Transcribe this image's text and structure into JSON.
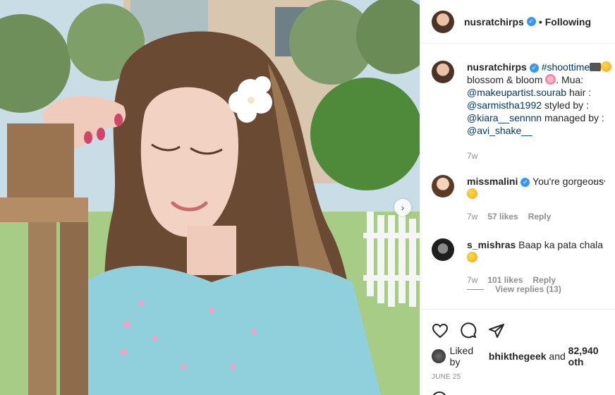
{
  "post": {
    "username": "nusratchirps",
    "follow_label": "Following",
    "verified_mark": "✓",
    "dot": "•"
  },
  "caption": {
    "username": "nusratchirps",
    "hashtag": "#shoottime",
    "line1_after_emoji": "blossom & bloom",
    "line1_tail": ". Mua:",
    "m1": "@makeupartist.sourab",
    "hair": " hair :",
    "m2": "@sarmistha1992",
    "styled": " styled by :",
    "m3": "@kiara__sennnn",
    "managed": " managed by :",
    "m4": "@avi_shake__",
    "time": "7w"
  },
  "comments": [
    {
      "username": "missmalini",
      "text": "You're gorgeous",
      "time": "7w",
      "likes": "57 likes",
      "reply": "Reply",
      "more": "···"
    },
    {
      "username": "s_mishras",
      "text": "Baap ka pata chala",
      "time": "7w",
      "likes": "101 likes",
      "reply": "Reply",
      "view_replies": "View replies (13)"
    }
  ],
  "footer": {
    "liked_prefix": "Liked by ",
    "liked_user": "bhikthegeek",
    "liked_mid": " and ",
    "liked_count": "82,940 oth",
    "date": "JUNE 25"
  },
  "icons": {
    "like": "heart-icon",
    "comment": "comment-icon",
    "share": "share-icon",
    "next": "chevron-right-icon"
  },
  "colors": {
    "link": "#00376b",
    "verified": "#3897f0",
    "muted": "#8e8e8e"
  }
}
